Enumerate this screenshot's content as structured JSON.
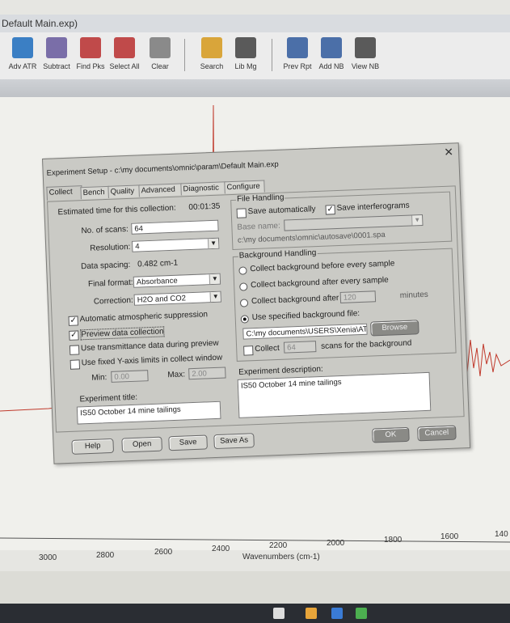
{
  "window": {
    "title_fragment": "Default Main.exp)"
  },
  "toolbar": {
    "buttons": [
      {
        "label": "Adv ATR",
        "icon": "adv-atr-icon",
        "color": "#3b7fc4"
      },
      {
        "label": "Subtract",
        "icon": "subtract-icon",
        "color": "#7a6ea8"
      },
      {
        "label": "Find Pks",
        "icon": "find-peaks-icon",
        "color": "#c04a4a"
      },
      {
        "label": "Select All",
        "icon": "select-all-icon",
        "color": "#c04a4a"
      },
      {
        "label": "Clear",
        "icon": "clear-icon",
        "color": "#8a8a8a"
      },
      {
        "label": "Search",
        "icon": "search-icon",
        "color": "#d9a53a"
      },
      {
        "label": "Lib Mg",
        "icon": "library-manager-icon",
        "color": "#5a5a5a"
      },
      {
        "label": "Prev Rpt",
        "icon": "preview-report-icon",
        "color": "#4b6fa8"
      },
      {
        "label": "Add NB",
        "icon": "add-notebook-icon",
        "color": "#4b6fa8"
      },
      {
        "label": "View NB",
        "icon": "view-notebook-icon",
        "color": "#5a5a5a"
      }
    ]
  },
  "plot": {
    "x_label": "Wavenumbers (cm-1)",
    "x_ticks": [
      "3000",
      "2800",
      "2600",
      "2400",
      "2200",
      "2000",
      "1800",
      "1600",
      "140"
    ],
    "trace_color": "#c0392b"
  },
  "dialog": {
    "title": "Experiment Setup - c:\\my documents\\omnic\\param\\Default Main.exp",
    "tabs": [
      "Collect",
      "Bench",
      "Quality",
      "Advanced",
      "Diagnostic",
      "Configure"
    ],
    "collect": {
      "estimated_time_label": "Estimated time for this collection:",
      "estimated_time_value": "00:01:35",
      "scans_label": "No. of scans:",
      "scans_value": "64",
      "resolution_label": "Resolution:",
      "resolution_value": "4",
      "spacing_label": "Data spacing:",
      "spacing_value": "0.482 cm-1",
      "format_label": "Final format:",
      "format_value": "Absorbance",
      "correction_label": "Correction:",
      "correction_value": "H2O and CO2",
      "auto_atm_label": "Automatic atmospheric suppression",
      "preview_label": "Preview data collection",
      "transmittance_label": "Use transmittance data during preview",
      "fixed_y_label": "Use fixed Y-axis limits in collect window",
      "min_label": "Min:",
      "min_value": "0.00",
      "max_label": "Max:",
      "max_value": "2.00",
      "exp_title_label": "Experiment title:",
      "exp_title_value": "IS50 October 14 mine tailings"
    },
    "file_handling": {
      "legend": "File Handling",
      "save_auto_label": "Save automatically",
      "save_interf_label": "Save interferograms",
      "base_name_label": "Base name:",
      "base_path": "c:\\my documents\\omnic\\autosave\\0001.spa"
    },
    "background": {
      "legend": "Background Handling",
      "opt1": "Collect background before every sample",
      "opt2": "Collect background after every sample",
      "opt3": "Collect background after",
      "opt3_value": "120",
      "opt3_unit": "minutes",
      "opt4": "Use specified background file:",
      "file_path": "C:\\my documents\\USERS\\Xenia\\ATR",
      "browse_label": "Browse",
      "collect_label": "Collect",
      "collect_scans": "64",
      "collect_suffix": "scans for the background"
    },
    "description": {
      "label": "Experiment description:",
      "value": "IS50 October 14 mine tailings"
    },
    "buttons": {
      "help": "Help",
      "open": "Open",
      "save": "Save",
      "save_as": "Save As",
      "ok": "OK",
      "cancel": "Cancel"
    }
  }
}
